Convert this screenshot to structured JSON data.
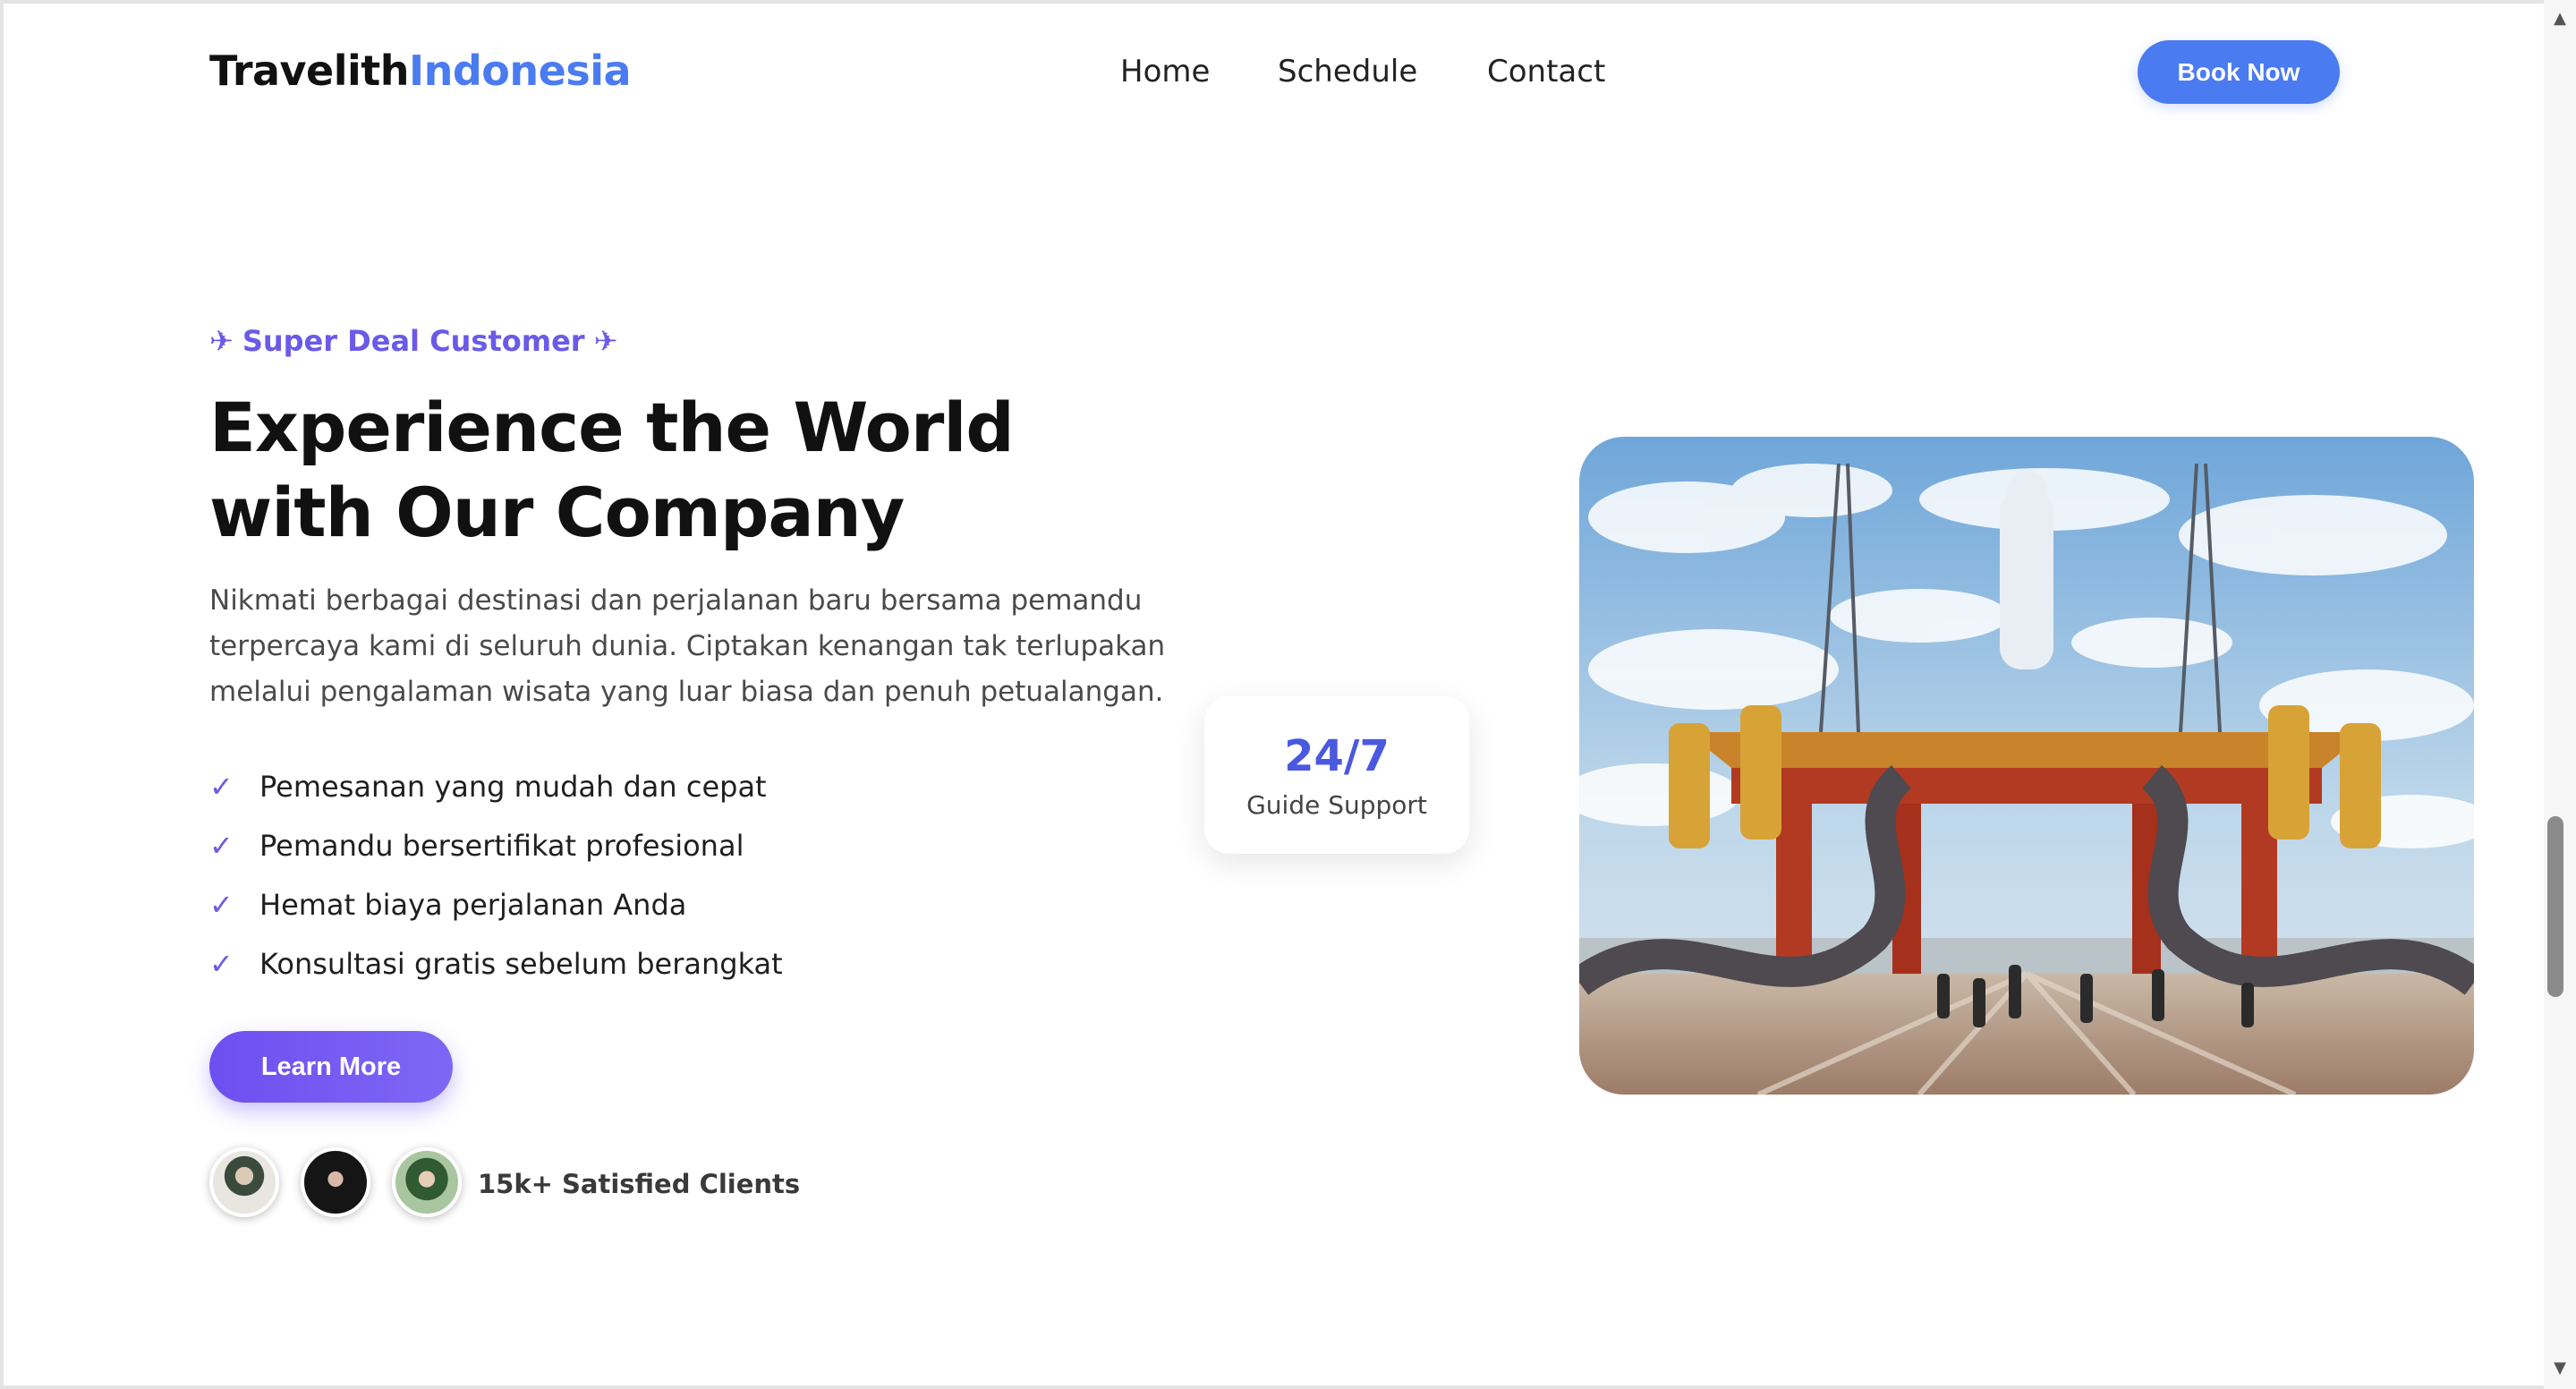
{
  "header": {
    "brand_part1": "Travelith",
    "brand_part2": "Indonesia",
    "nav": [
      "Home",
      "Schedule",
      "Contact"
    ],
    "cta_label": "Book Now"
  },
  "hero": {
    "eyebrow": "Super Deal Customer",
    "headline_line1": "Experience the World",
    "headline_line2": "with Our Company",
    "description": "Nikmati berbagai destinasi dan perjalanan baru bersama pemandu terpercaya kami di seluruh dunia. Ciptakan kenangan tak terlupakan melalui pengalaman wisata yang luar biasa dan penuh petualangan.",
    "features": [
      "Pemesanan yang mudah dan cepat",
      "Pemandu bersertifikat profesional",
      "Hemat biaya perjalanan Anda",
      "Konsultasi gratis sebelum berangkat"
    ],
    "learn_more_label": "Learn More",
    "clients_text": "15k+ Satisfied Clients"
  },
  "support_card": {
    "number": "24/7",
    "label": "Guide Support"
  },
  "icons": {
    "eyebrow_left": "airplane-icon",
    "eyebrow_right": "airplane-icon",
    "feature_bullet": "check-icon",
    "check_glyph": "✓",
    "plane_glyph": "✈"
  },
  "colors": {
    "brand_accent": "#4a7bf0",
    "purple_accent": "#6b5ae8",
    "support_number": "#4a59e0"
  }
}
